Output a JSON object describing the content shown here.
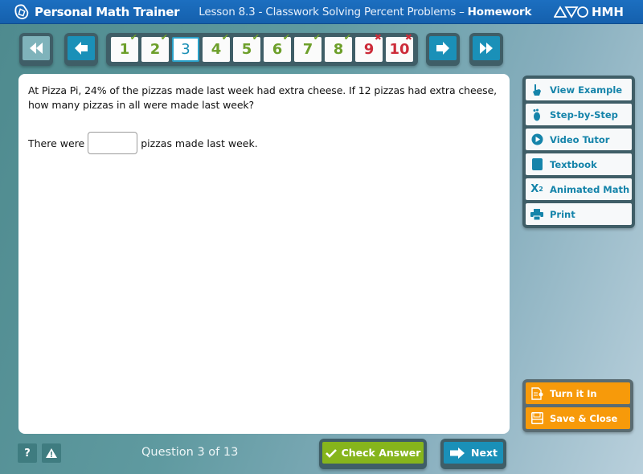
{
  "header": {
    "brand": "Personal Math Trainer",
    "lesson": "Lesson 8.3 - Classwork Solving Percent Problems",
    "dash": "–",
    "mode": "Homework",
    "publisher": "HMH"
  },
  "nav": {
    "first_icon": "double-arrow-left-icon",
    "prev_icon": "arrow-left-icon",
    "next_icon": "arrow-right-icon",
    "last_icon": "double-arrow-right-icon",
    "questions": [
      {
        "label": "1",
        "status": "correct"
      },
      {
        "label": "2",
        "status": "correct"
      },
      {
        "label": "3",
        "status": "current"
      },
      {
        "label": "4",
        "status": "correct"
      },
      {
        "label": "5",
        "status": "correct"
      },
      {
        "label": "6",
        "status": "correct"
      },
      {
        "label": "7",
        "status": "correct"
      },
      {
        "label": "8",
        "status": "correct"
      },
      {
        "label": "9",
        "status": "wrong"
      },
      {
        "label": "10",
        "status": "wrong"
      }
    ],
    "check_mark": "✔",
    "x_mark": "✖"
  },
  "question": {
    "text": "At Pizza Pi, 24% of the pizzas made last week had extra cheese. If 12 pizzas had extra cheese, how many pizzas in all were made last week?",
    "answer_prefix": "There were",
    "answer_value": "",
    "answer_suffix": "pizzas made last week."
  },
  "tools": [
    {
      "label": "View Example",
      "icon": "hand-pointer-icon"
    },
    {
      "label": "Step-by-Step",
      "icon": "footprint-icon"
    },
    {
      "label": "Video Tutor",
      "icon": "play-icon"
    },
    {
      "label": "Textbook",
      "icon": "book-icon"
    },
    {
      "label": "Animated Math",
      "icon": "x-squared-icon"
    },
    {
      "label": "Print",
      "icon": "printer-icon"
    }
  ],
  "actions": [
    {
      "label": "Turn it In",
      "icon": "document-icon"
    },
    {
      "label": "Save & Close",
      "icon": "floppy-disk-icon"
    }
  ],
  "footer": {
    "help_label": "?",
    "warning_label": "!",
    "question_count": "Question 3 of 13",
    "check_answer": "Check Answer",
    "next": "Next"
  },
  "colors": {
    "header_blue": "#1c6fc0",
    "correct_green": "#6d9f2a",
    "wrong_red": "#cc2b39",
    "accent_teal": "#1a90b8",
    "tool_text": "#1584aa",
    "orange": "#f79a0a",
    "check_green": "#86b51c"
  }
}
